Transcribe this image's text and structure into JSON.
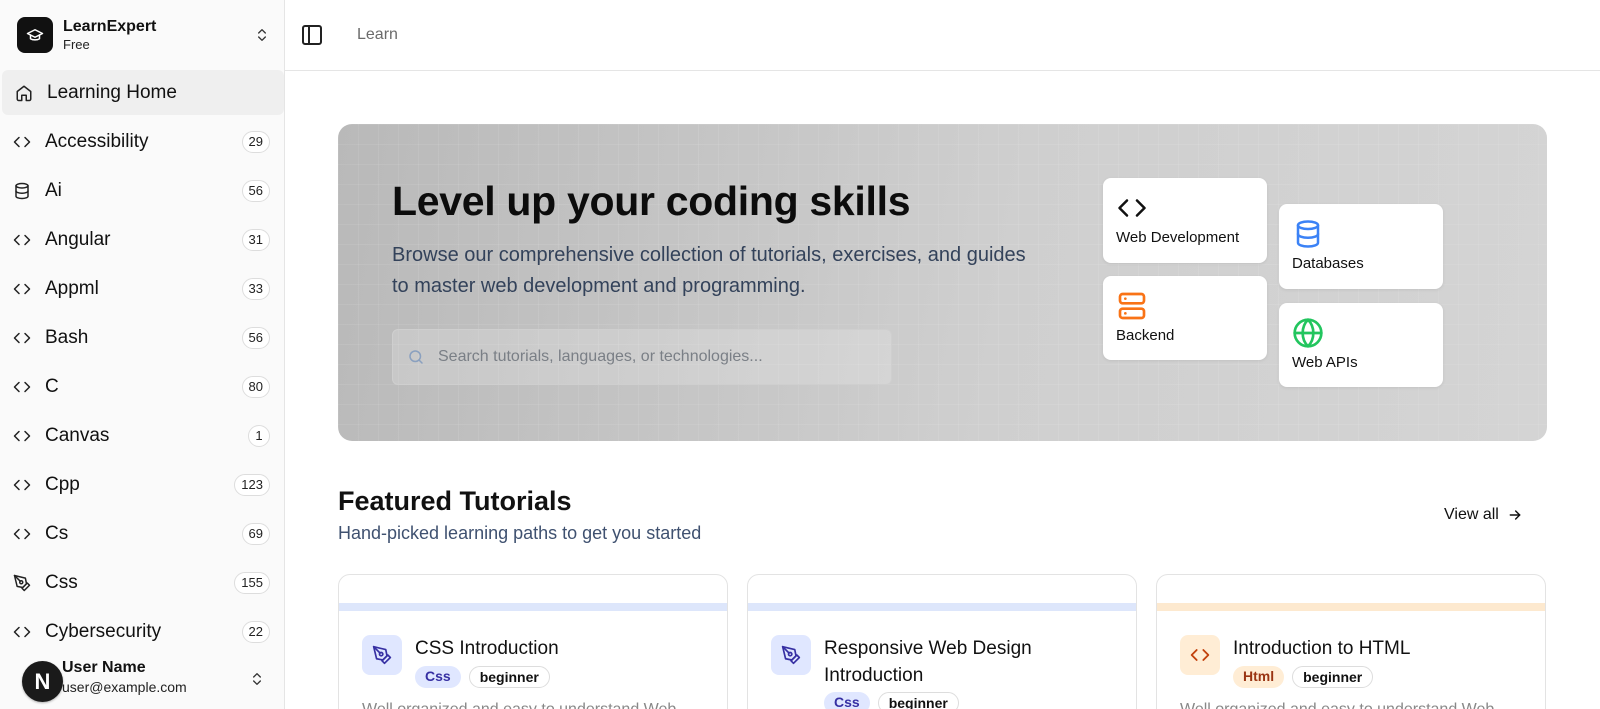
{
  "brand": {
    "name": "LearnExpert",
    "plan": "Free",
    "icon": "graduation-cap-icon"
  },
  "sidebar": {
    "items": [
      {
        "label": "Learning Home",
        "icon": "home-icon",
        "count": null,
        "active": true
      },
      {
        "label": "Accessibility",
        "icon": "code-icon",
        "count": "29"
      },
      {
        "label": "Ai",
        "icon": "database-icon",
        "count": "56"
      },
      {
        "label": "Angular",
        "icon": "code-icon",
        "count": "31"
      },
      {
        "label": "Appml",
        "icon": "code-icon",
        "count": "33"
      },
      {
        "label": "Bash",
        "icon": "code-icon",
        "count": "56"
      },
      {
        "label": "C",
        "icon": "code-icon",
        "count": "80"
      },
      {
        "label": "Canvas",
        "icon": "code-icon",
        "count": "1"
      },
      {
        "label": "Cpp",
        "icon": "code-icon",
        "count": "123"
      },
      {
        "label": "Cs",
        "icon": "code-icon",
        "count": "69"
      },
      {
        "label": "Css",
        "icon": "pen-tool-icon",
        "count": "155"
      },
      {
        "label": "Cybersecurity",
        "icon": "code-icon",
        "count": "22"
      }
    ]
  },
  "user": {
    "initial": "N",
    "name": "User Name",
    "email": "user@example.com"
  },
  "topbar": {
    "breadcrumb": "Learn"
  },
  "hero": {
    "title": "Level up your coding skills",
    "subtitle": "Browse our comprehensive collection of tutorials, exercises, and guides to master web development and programming.",
    "search_placeholder": "Search tutorials, languages, or technologies...",
    "categories": [
      {
        "label": "Web Development",
        "icon": "code-icon",
        "color": "#111111"
      },
      {
        "label": "Databases",
        "icon": "database-icon",
        "color": "#3b82f6"
      },
      {
        "label": "Backend",
        "icon": "server-icon",
        "color": "#f97316"
      },
      {
        "label": "Web APIs",
        "icon": "globe-icon",
        "color": "#22c55e"
      }
    ]
  },
  "featured": {
    "title": "Featured Tutorials",
    "subtitle": "Hand-picked learning paths to get you started",
    "view_all": "View all",
    "cards": [
      {
        "title": "CSS Introduction",
        "tag": "Css",
        "level": "beginner",
        "desc": "Well organized and easy to understand Web",
        "band": "#dde6fb",
        "icon": "pen-tool-icon",
        "tag_bg": "#e0e7ff",
        "tag_color": "#3730a3",
        "icon_bg": "#e0e7ff",
        "icon_color": "#3730a3"
      },
      {
        "title": "Responsive Web Design Introduction",
        "tag": "Css",
        "level": "beginner",
        "desc": "",
        "band": "#dde6fb",
        "icon": "pen-tool-icon",
        "tag_bg": "#e0e7ff",
        "tag_color": "#3730a3",
        "icon_bg": "#e0e7ff",
        "icon_color": "#3730a3"
      },
      {
        "title": "Introduction to HTML",
        "tag": "Html",
        "level": "beginner",
        "desc": "Well organized and easy to understand Web",
        "band": "#fde9cf",
        "icon": "code-icon",
        "tag_bg": "#ffedd5",
        "tag_color": "#9a3412",
        "icon_bg": "#ffedd5",
        "icon_color": "#c2410c"
      }
    ]
  }
}
